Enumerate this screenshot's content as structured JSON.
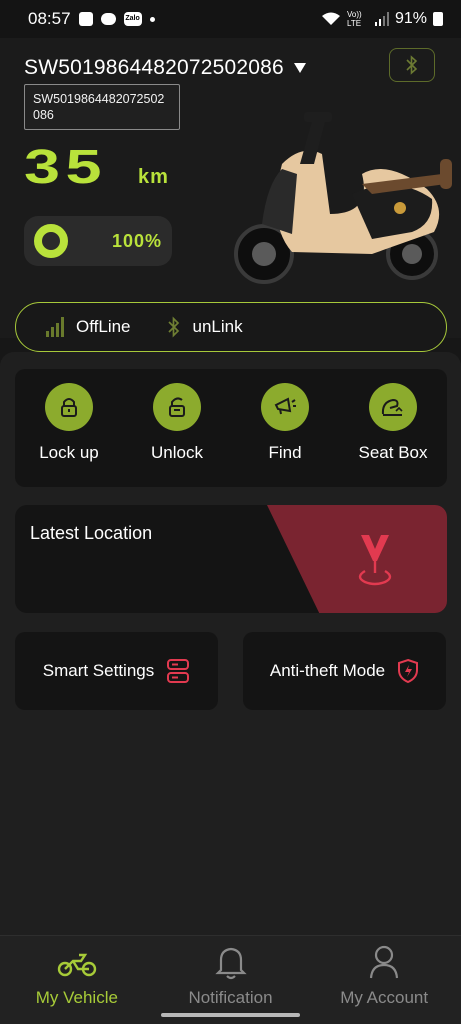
{
  "status_bar": {
    "time": "08:57",
    "app_icons": [
      "check-square-icon",
      "chat-bubble-icon",
      "zalo-icon",
      "dot-icon"
    ],
    "zalo_label": "Zalo",
    "network": "Vo)) LTE",
    "battery": "91%"
  },
  "vehicle": {
    "device_id": "SW5019864482072502086",
    "tooltip_text": "SW5019864482072502086",
    "range_value": "35",
    "range_unit": "km",
    "battery_percent": "100%",
    "battery_level": 1.0
  },
  "connection": {
    "network_status": "OffLine",
    "bluetooth_status": "unLink"
  },
  "actions": [
    {
      "label": "Lock up",
      "icon": "lock-icon"
    },
    {
      "label": "Unlock",
      "icon": "unlock-icon"
    },
    {
      "label": "Find",
      "icon": "horn-icon"
    },
    {
      "label": "Seat Box",
      "icon": "seat-box-icon"
    }
  ],
  "location": {
    "title": "Latest Location"
  },
  "settings": {
    "smart_label": "Smart Settings",
    "anti_theft_label": "Anti-theft Mode"
  },
  "nav": [
    {
      "label": "My Vehicle",
      "icon": "scooter-icon",
      "active": true
    },
    {
      "label": "Notification",
      "icon": "bell-icon",
      "active": false
    },
    {
      "label": "My Account",
      "icon": "user-icon",
      "active": false
    }
  ],
  "colors": {
    "accent_green": "#b9e23b",
    "action_green": "#8cab2d",
    "alert_red": "#e23a50",
    "background": "#171717"
  }
}
